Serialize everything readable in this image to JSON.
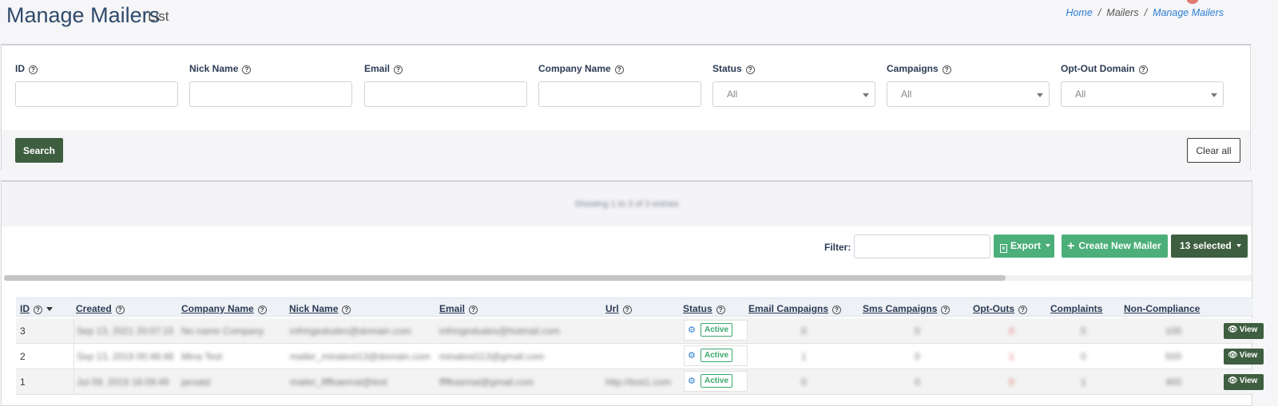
{
  "header": {
    "title": "Manage Mailers",
    "subtitle": "List",
    "breadcrumb": [
      "Home",
      "Mailers",
      "Manage Mailers"
    ],
    "breadcrumb_separator": "/"
  },
  "search": {
    "fields": [
      {
        "label": "ID",
        "type": "text",
        "value": ""
      },
      {
        "label": "Nick Name",
        "type": "text",
        "value": ""
      },
      {
        "label": "Email",
        "type": "text",
        "value": ""
      },
      {
        "label": "Company Name",
        "type": "text",
        "value": ""
      },
      {
        "label": "Status",
        "type": "select",
        "value": "All"
      },
      {
        "label": "Campaigns",
        "type": "select",
        "value": "All"
      },
      {
        "label": "Opt-Out Domain",
        "type": "select",
        "value": "All"
      }
    ],
    "help_icon_glyph": "?",
    "search_button": "Search",
    "clear_button": "Clear all"
  },
  "list": {
    "showing_text": "Showing 1 to 3 of 3 entries",
    "filter_label": "Filter:",
    "filter_value": "",
    "export_button": "Export",
    "export_icon": "excel-icon",
    "create_button": "Create New Mailer",
    "create_icon": "plus-icon",
    "selected_button": "13 selected",
    "columns": [
      "ID",
      "Created",
      "Company Name",
      "Nick Name",
      "Email",
      "Url",
      "Status",
      "Email Campaigns",
      "Sms Campaigns",
      "Opt-Outs",
      "Complaints",
      "Non-Compliance"
    ],
    "rows": [
      {
        "id": "3",
        "created": "Sep 13, 2021 20:07:15",
        "company": "No name Company",
        "nick": "infringedsales@domain.com",
        "email": "infringedsales@hotmail.com",
        "url": "",
        "status": "Active",
        "email_campaigns": "0",
        "sms_campaigns": "0",
        "opt_outs": "0",
        "complaints": "0",
        "non_compliance": "100",
        "view": "View"
      },
      {
        "id": "2",
        "created": "Sep 13, 2019 00:48:48",
        "company": "Mina Test",
        "nick": "mailer_minatest13@domain.com",
        "email": "minatest113@gmail.com",
        "url": "",
        "status": "Active",
        "email_campaigns": "1",
        "sms_campaigns": "0",
        "opt_outs": "1",
        "complaints": "0",
        "non_compliance": "500",
        "view": "View"
      },
      {
        "id": "1",
        "created": "Jul 09, 2019 16:09:49",
        "company": "jarsatd",
        "nick": "mailer_lfffkaemal@test",
        "email": "ffffkaemal@gmail.com",
        "url": "http://test1.com",
        "status": "Active",
        "email_campaigns": "0",
        "sms_campaigns": "0",
        "opt_outs": "0",
        "complaints": "1",
        "non_compliance": "400",
        "view": "View"
      }
    ],
    "colors": {
      "primary_dark": "#3e5e40",
      "success": "#4caf7a",
      "active_badge": "#3aa76d",
      "link": "#2d7dd2",
      "opt_out": "#e26b6b"
    }
  }
}
